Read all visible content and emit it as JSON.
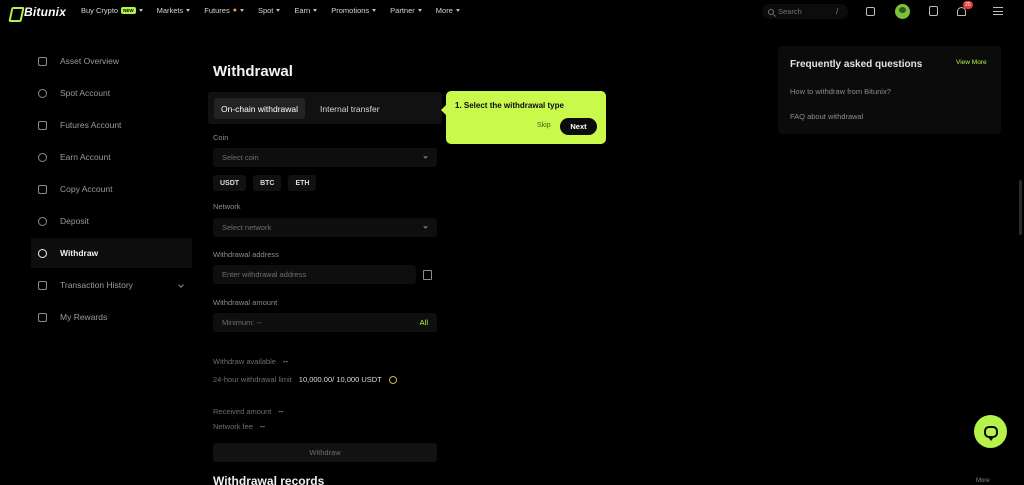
{
  "brand": {
    "name": "Bitunix"
  },
  "nav": {
    "items": [
      {
        "label": "Buy Crypto",
        "badge": "NEW"
      },
      {
        "label": "Markets"
      },
      {
        "label": "Futures",
        "badge_icon": "fire-icon"
      },
      {
        "label": "Spot"
      },
      {
        "label": "Earn"
      },
      {
        "label": "Promotions"
      },
      {
        "label": "Partner"
      },
      {
        "label": "More"
      }
    ],
    "search_placeholder": "Search",
    "search_shortcut": "/",
    "notification_count": "20"
  },
  "sidebar": {
    "items": [
      {
        "label": "Asset Overview",
        "icon": "wallet-icon"
      },
      {
        "label": "Spot Account",
        "icon": "spot-icon"
      },
      {
        "label": "Futures Account",
        "icon": "futures-icon"
      },
      {
        "label": "Earn Account",
        "icon": "earn-icon"
      },
      {
        "label": "Copy Account",
        "icon": "copy-account-icon"
      },
      {
        "label": "Deposit",
        "icon": "deposit-icon"
      },
      {
        "label": "Withdraw",
        "icon": "withdraw-icon",
        "active": true
      },
      {
        "label": "Transaction History",
        "icon": "history-icon",
        "expandable": true
      },
      {
        "label": "My Rewards",
        "icon": "rewards-icon"
      }
    ]
  },
  "main": {
    "title": "Withdrawal",
    "tabs": [
      {
        "label": "On-chain withdrawal",
        "active": true
      },
      {
        "label": "Internal transfer"
      }
    ],
    "coin": {
      "label": "Coin",
      "placeholder": "Select coin",
      "quick": [
        "USDT",
        "BTC",
        "ETH"
      ]
    },
    "network": {
      "label": "Network",
      "placeholder": "Select network"
    },
    "address": {
      "label": "Withdrawal address",
      "placeholder": "Enter withdrawal address"
    },
    "amount": {
      "label": "Withdrawal amount",
      "placeholder": "Minimum: --",
      "all_label": "All"
    },
    "available": {
      "label": "Withdraw available",
      "value": "--"
    },
    "limit": {
      "label": "24-hour withdrawal limit",
      "value": "10,000.00/ 10,000 USDT"
    },
    "received": {
      "label": "Received amount",
      "value": "--"
    },
    "fee": {
      "label": "Network fee",
      "value": "--"
    },
    "submit_label": "Withdraw",
    "records_title": "Withdrawal records",
    "more_label": "More"
  },
  "tour": {
    "title": "1. Select the withdrawal type",
    "skip_label": "Skip",
    "next_label": "Next"
  },
  "faq": {
    "title": "Frequently asked questions",
    "view_more": "View More",
    "items": [
      "How to withdraw from Bitunix?",
      "FAQ about withdrawal"
    ]
  },
  "colors": {
    "accent": "#b5f34a",
    "tour_bg": "#c8f94b",
    "background": "#000000"
  }
}
